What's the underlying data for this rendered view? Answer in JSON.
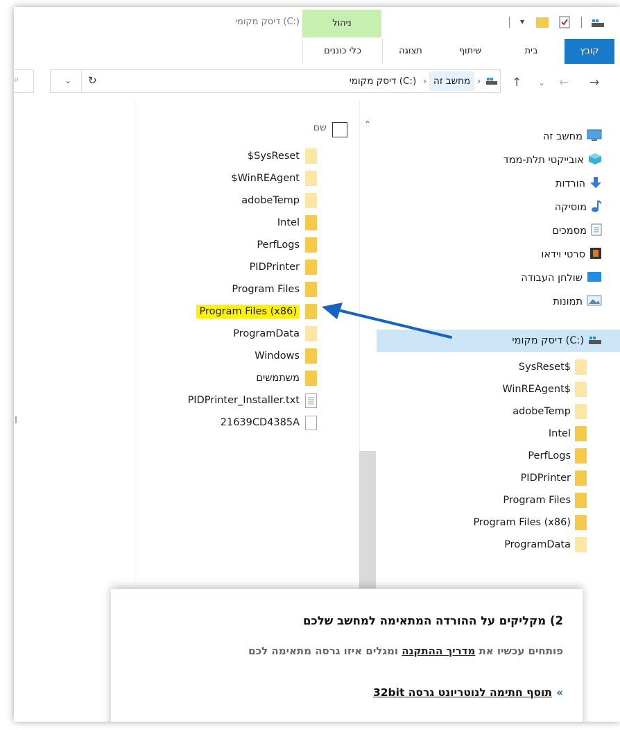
{
  "title_bar": {
    "manage_tab": "ניהול",
    "window_title": "דיסק מקומי (C:)"
  },
  "ribbon": {
    "tabs": [
      "קובץ",
      "בית",
      "שיתוף",
      "תצוגה",
      "כלי כוננים"
    ]
  },
  "address_bar": {
    "crumbs": [
      "מחשב זה",
      "דיסק מקומי (C:)"
    ],
    "separator": "›"
  },
  "file_list": {
    "header_name": "שם",
    "items": [
      {
        "name": "$SysReset",
        "icon": "folder-light"
      },
      {
        "name": "$WinREAgent",
        "icon": "folder-light"
      },
      {
        "name": "adobeTemp",
        "icon": "folder-light"
      },
      {
        "name": "Intel",
        "icon": "folder"
      },
      {
        "name": "PerfLogs",
        "icon": "folder"
      },
      {
        "name": "PIDPrinter",
        "icon": "folder"
      },
      {
        "name": "Program Files",
        "icon": "folder"
      },
      {
        "name": "Program Files (x86)",
        "icon": "folder",
        "highlighted": true
      },
      {
        "name": "ProgramData",
        "icon": "folder-light"
      },
      {
        "name": "Windows",
        "icon": "folder"
      },
      {
        "name": "משתמשים",
        "icon": "folder"
      },
      {
        "name": "PIDPrinter_Installer.txt",
        "icon": "text-file"
      },
      {
        "name": "21639CD4385A",
        "icon": "blank-file"
      }
    ]
  },
  "nav_pane": {
    "items": [
      {
        "name": "מחשב זה",
        "icon": "monitor-icon"
      },
      {
        "name": "אובייקטי תלת-ממד",
        "icon": "cube-3d-icon"
      },
      {
        "name": "הורדות",
        "icon": "download-arrow-icon"
      },
      {
        "name": "מוסיקה",
        "icon": "music-note-icon"
      },
      {
        "name": "מסמכים",
        "icon": "documents-icon"
      },
      {
        "name": "סרטי וידאו",
        "icon": "film-icon"
      },
      {
        "name": "שולחן העבודה",
        "icon": "desktop-icon"
      },
      {
        "name": "תמונות",
        "icon": "pictures-icon"
      },
      {
        "name": "דיסק מקומי (C:)",
        "icon": "drive-icon",
        "selected": true
      }
    ],
    "drive_children": [
      "SysReset$",
      "WinREAgent$",
      "adobeTemp",
      "Intel",
      "PerfLogs",
      "PIDPrinter",
      "Program Files",
      "Program Files (x86)",
      "ProgramData"
    ]
  },
  "overlay": {
    "heading": "2) מקליקים על ההורדה המתאימה למחשב שלכם",
    "text_before": "פותחים עכשיו את",
    "link": "מדריך ההתקנה",
    "text_after": "ומגלים איזו גרסה מתאימה לכם",
    "cta_marker": "»",
    "cta": "תוסף חתימה לנוטריונט גרסה 32bit"
  },
  "colors": {
    "file_tab": "#1979ca",
    "manage_tab": "#c6efb0",
    "selected_nav": "#cce6f7",
    "highlight": "#fff200",
    "arrow": "#1565c0"
  }
}
